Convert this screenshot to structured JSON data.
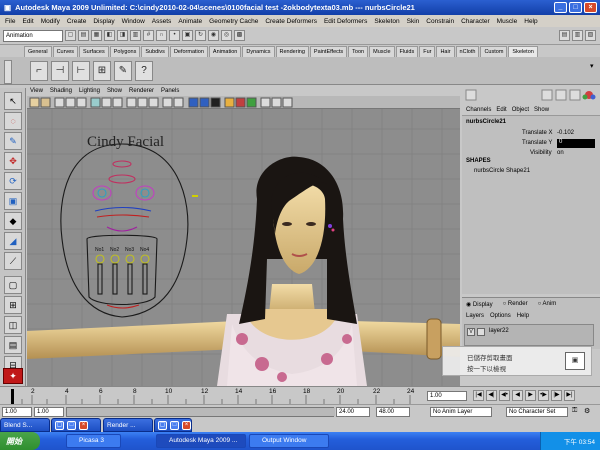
{
  "window": {
    "title": "Autodesk Maya 2009 Unlimited: C:\\cindy2010-02-04\\scenes\\0100facial test -2okbodytexta03.mb  ---  nurbsCircle21"
  },
  "menubar": [
    "File",
    "Edit",
    "Modify",
    "Create",
    "Display",
    "Window",
    "Assets",
    "Animate",
    "Geometry Cache",
    "Create Deformers",
    "Edit Deformers",
    "Skeleton",
    "Skin",
    "Constrain",
    "Character",
    "Muscle",
    "Help"
  ],
  "mode_selector": "Animation",
  "shelf_tabs": [
    "General",
    "Curves",
    "Surfaces",
    "Polygons",
    "Subdivs",
    "Deformation",
    "Animation",
    "Dynamics",
    "Rendering",
    "PaintEffects",
    "Toon",
    "Muscle",
    "Fluids",
    "Fur",
    "Hair",
    "nCloth",
    "Custom",
    "Skeleton"
  ],
  "shelf_icons": [
    "joint-icon",
    "ik-handle-icon",
    "ik-spline-icon",
    "paint-weights-icon",
    "brush-icon",
    "help-icon"
  ],
  "panel_menu": [
    "View",
    "Shading",
    "Lighting",
    "Show",
    "Renderer",
    "Panels"
  ],
  "channel_menu": [
    "Channels",
    "Edit",
    "Object",
    "Show"
  ],
  "channel_box": {
    "object": "nurbsCircle21",
    "attrs": [
      {
        "name": "Translate X",
        "value": "-0.102"
      },
      {
        "name": "Translate Y",
        "value": "0"
      },
      {
        "name": "Visibility",
        "value": "on"
      }
    ],
    "shapes_label": "SHAPES",
    "shape": "nurbsCircle Shape21"
  },
  "layer_modes": [
    "Display",
    "Render",
    "Anim"
  ],
  "layer_menu": [
    "Layers",
    "Options",
    "Help"
  ],
  "layer_item": "layer22",
  "facial_board": {
    "title": "Cindy Facial",
    "sliders": [
      "No1",
      "No2",
      "No3",
      "No4"
    ]
  },
  "timeline": {
    "ticks": [
      "2",
      "4",
      "6",
      "8",
      "10",
      "12",
      "14",
      "16",
      "18",
      "20",
      "22",
      "24"
    ],
    "current": "1.00"
  },
  "range": {
    "start": "1.00",
    "range_start": "1.00",
    "range_end": "24.00",
    "end": "48.00",
    "anim_layer": "No Anim Layer",
    "char_set": "No Character Set"
  },
  "minimized": [
    {
      "label": "Blend S..."
    },
    {
      "label": "Render ..."
    }
  ],
  "taskbar": {
    "start_label": "開始",
    "tasks": [
      "Picasa 3",
      "Autodesk Maya 2009 ...",
      "Output Window"
    ],
    "clock": "下午 03:54"
  },
  "notification": {
    "line1": "已儲存剪取畫面",
    "line2": "按一下以檢視"
  },
  "colors": {
    "titlebar": "#1f4fc0",
    "viewport_bg": "#8d8d8d",
    "taskbar": "#245edb",
    "start": "#3a9a3a"
  }
}
